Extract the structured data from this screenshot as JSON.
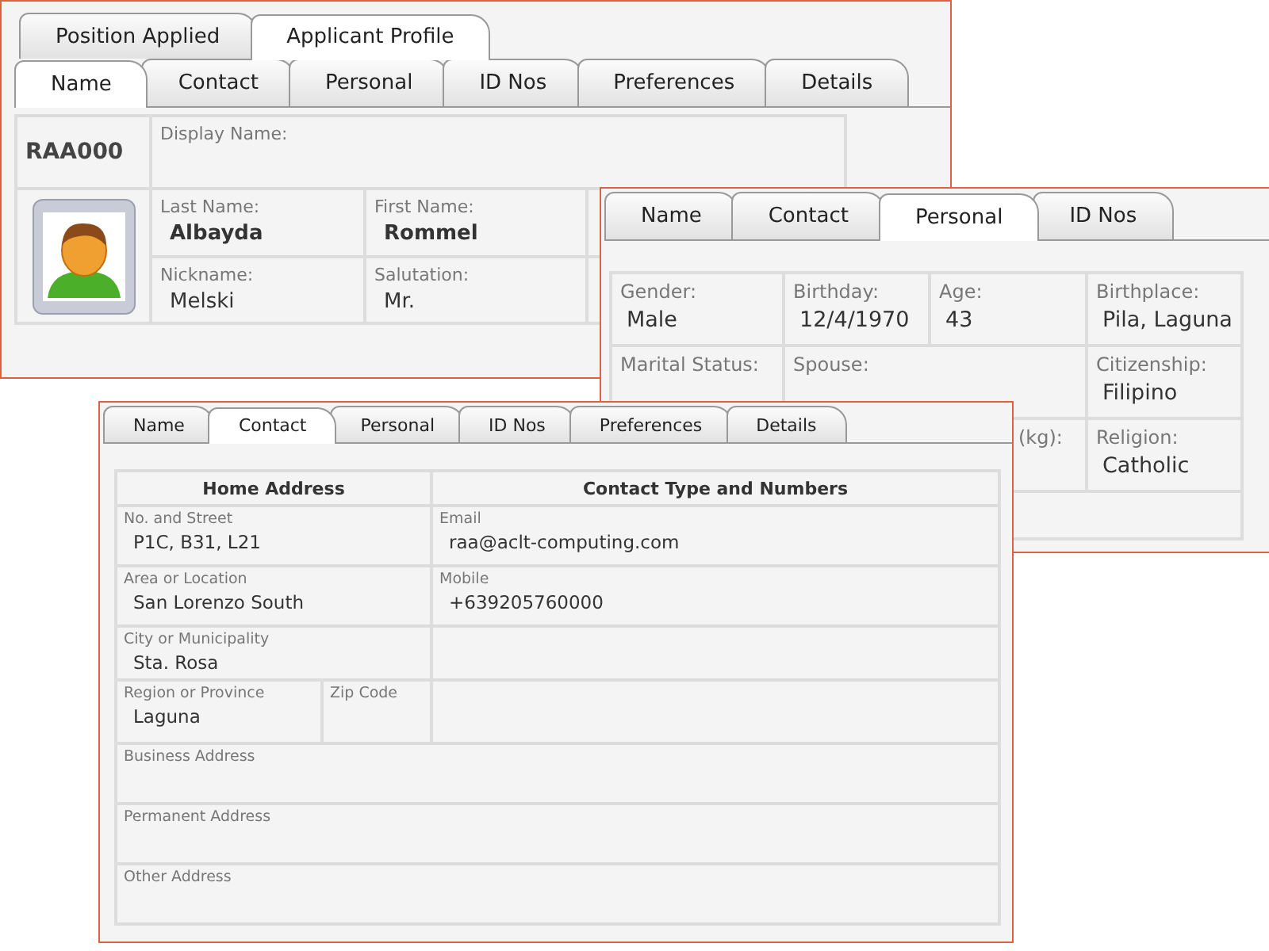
{
  "applicant_window": {
    "top_tabs": [
      {
        "label": "Position Applied",
        "selected": false
      },
      {
        "label": "Applicant Profile",
        "selected": true
      }
    ],
    "tabs": [
      {
        "label": "Name",
        "selected": true
      },
      {
        "label": "Contact",
        "selected": false
      },
      {
        "label": "Personal",
        "selected": false
      },
      {
        "label": "ID Nos",
        "selected": false
      },
      {
        "label": "Preferences",
        "selected": false
      },
      {
        "label": "Details",
        "selected": false
      }
    ],
    "code": "RAA000",
    "display_name_label": "Display Name:",
    "fields": [
      {
        "label": "Last Name:",
        "value": "Albayda"
      },
      {
        "label": "First Name:",
        "value": "Rommel"
      },
      {
        "label": "Nickname:",
        "value": "Melski"
      },
      {
        "label": "Salutation:",
        "value": "Mr."
      }
    ]
  },
  "personal_window": {
    "tabs": [
      {
        "label": "Name",
        "selected": false
      },
      {
        "label": "Contact",
        "selected": false
      },
      {
        "label": "Personal",
        "selected": true
      },
      {
        "label": "ID Nos",
        "selected": false
      }
    ],
    "fields": [
      {
        "label": "Gender:",
        "value": "Male"
      },
      {
        "label": "Birthday:",
        "value": "12/4/1970"
      },
      {
        "label": "Age:",
        "value": "43"
      },
      {
        "label": "Birthplace:",
        "value": "Pila, Laguna"
      },
      {
        "label": "Marital Status:"
      },
      {
        "label": "Spouse:"
      },
      {
        "label": "Citizenship:",
        "value": "Filipino"
      },
      {
        "label": "(kg):"
      },
      {
        "label": "Religion:",
        "value": "Catholic"
      }
    ]
  },
  "contact_window": {
    "tabs": [
      {
        "label": "Name",
        "selected": false
      },
      {
        "label": "Contact",
        "selected": true
      },
      {
        "label": "Personal",
        "selected": false
      },
      {
        "label": "ID Nos",
        "selected": false
      },
      {
        "label": "Preferences",
        "selected": false
      },
      {
        "label": "Details",
        "selected": false
      }
    ],
    "headings": [
      "Home Address",
      "Contact Type and Numbers"
    ],
    "home_fields": [
      {
        "label": "No. and Street",
        "value": "P1C, B31, L21"
      },
      {
        "label": "Area or Location",
        "value": "San Lorenzo South"
      },
      {
        "label": "City or Municipality",
        "value": "Sta. Rosa"
      },
      {
        "label": "Region or Province",
        "value": "Laguna"
      },
      {
        "label": "Zip Code"
      }
    ],
    "contact_fields": [
      {
        "label": "Email",
        "value": "raa@aclt-computing.com"
      },
      {
        "label": "Mobile",
        "value": "+639205760000"
      }
    ],
    "other_addresses": [
      "Business Address",
      "Permanent Address",
      "Other Address"
    ]
  }
}
